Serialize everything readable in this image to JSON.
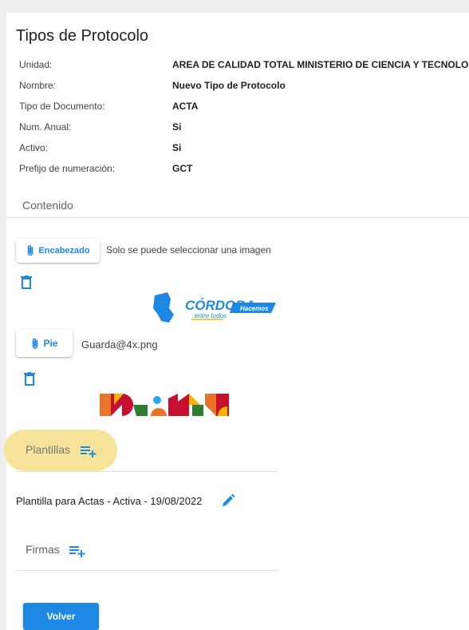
{
  "page": {
    "title": "Tipos de Protocolo"
  },
  "info": [
    {
      "label": "Unidad:",
      "value": "AREA DE CALIDAD TOTAL MINISTERIO DE CIENCIA Y TECNOLOGIA"
    },
    {
      "label": "Nombre:",
      "value": "Nuevo Tipo de Protocolo"
    },
    {
      "label": "Tipo de Documento:",
      "value": "ACTA"
    },
    {
      "label": "Num. Anual:",
      "value": "Si"
    },
    {
      "label": "Activo:",
      "value": "Si"
    },
    {
      "label": "Prefijo de numeración:",
      "value": "GCT"
    }
  ],
  "contenido": {
    "title": "Contenido",
    "encabezado": {
      "button_label": "Encabezado",
      "note": "Solo se puede seleccionar una imagen"
    },
    "pie": {
      "button_label": "Pie",
      "filename": "Guarda@4x.png"
    },
    "logo": {
      "main": "CÓRDOBA",
      "sub": "entre todos",
      "tag": "Hacemos"
    }
  },
  "plantillas": {
    "title": "Plantillas",
    "item": "Plantilla para Actas - Activa - 19/08/2022"
  },
  "firmas": {
    "title": "Firmas"
  },
  "actions": {
    "volver_label": "Volver"
  },
  "colors": {
    "primary": "#1e88e5",
    "highlight": "#f5e49a"
  }
}
